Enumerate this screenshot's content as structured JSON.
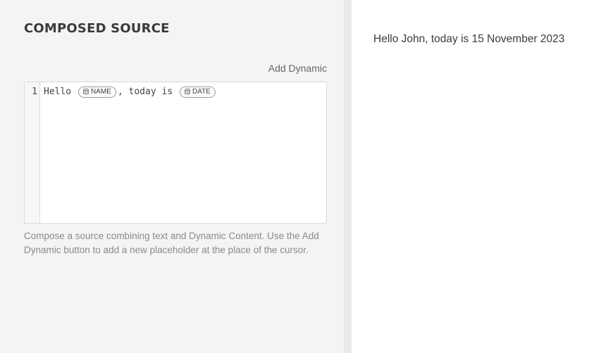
{
  "composer": {
    "title": "COMPOSED SOURCE",
    "add_dynamic_label": "Add Dynamic",
    "editor": {
      "line_number": "1",
      "segments": {
        "text_1": "Hello ",
        "chip_1": "NAME",
        "text_2": ", today is ",
        "chip_2": "DATE"
      },
      "chip_icon": "database-icon"
    },
    "help_text": "Compose a source combining text and Dynamic Content. Use the Add Dynamic button to add a new placeholder at the place of the cursor."
  },
  "preview": {
    "text": "Hello John, today is 15 November 2023"
  }
}
